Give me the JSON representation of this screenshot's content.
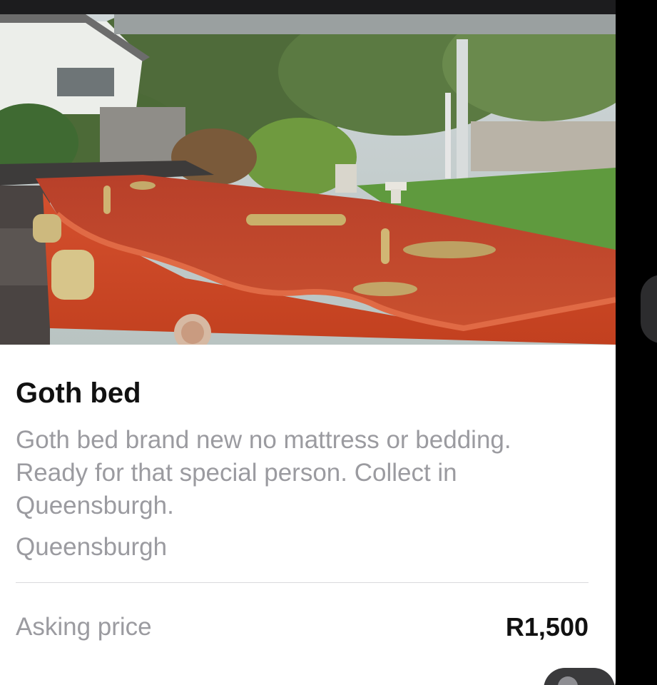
{
  "listing": {
    "title": "Goth bed",
    "description": "Goth bed brand new no mattress or bedding. Ready for that special person. Collect in Queensburgh.",
    "location": "Queensburgh",
    "price_label": "Asking price",
    "price_value": "R1,500"
  },
  "photo": {
    "subject": "red wooden coffin with brass handles on a trailer in a garden"
  },
  "colors": {
    "card_background": "#ffffff",
    "title_text": "#111111",
    "secondary_text": "#9b9ba0",
    "divider": "#d9d9dc",
    "coffin_red": "#c8462a",
    "screen_background": "#000000"
  }
}
